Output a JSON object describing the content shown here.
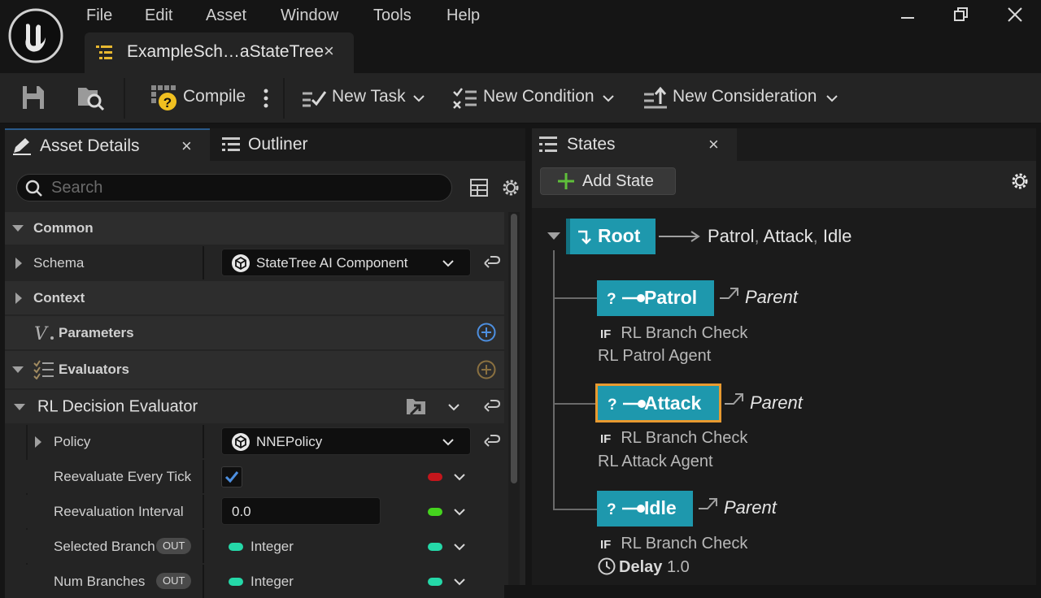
{
  "menu": [
    "File",
    "Edit",
    "Asset",
    "Window",
    "Tools",
    "Help"
  ],
  "document_tab": {
    "title": "ExampleSch…aStateTree",
    "close": "×"
  },
  "toolbar": {
    "compile": "Compile",
    "new_task": "New Task",
    "new_condition": "New Condition",
    "new_consideration": "New Consideration"
  },
  "left_tabs": {
    "asset_details": "Asset Details",
    "outliner": "Outliner",
    "close": "×"
  },
  "search": {
    "placeholder": "Search"
  },
  "details": {
    "common": "Common",
    "schema": {
      "label": "Schema",
      "value": "StateTree AI Component"
    },
    "context": "Context",
    "parameters": "Parameters",
    "evaluators": "Evaluators",
    "evaluator": "RL Decision Evaluator",
    "policy": {
      "label": "Policy",
      "value": "NNEPolicy"
    },
    "reevaluate": {
      "label": "Reevaluate Every Tick",
      "checked": true
    },
    "interval": {
      "label": "Reevaluation Interval",
      "value": "0.0"
    },
    "selected_branch": {
      "label": "Selected Branch",
      "badge": "OUT",
      "type": "Integer"
    },
    "num_branches": {
      "label": "Num Branches",
      "badge": "OUT",
      "type": "Integer"
    }
  },
  "states_panel": {
    "tab": "States",
    "close": "×",
    "add_state": "Add State"
  },
  "tree": {
    "root": {
      "label": "Root",
      "children": [
        "Patrol",
        "Attack",
        "Idle"
      ],
      "sep": ","
    },
    "states": [
      {
        "label": "Patrol",
        "transition": "Parent",
        "if": "IF",
        "condition": "RL Branch Check",
        "task": "RL Patrol Agent"
      },
      {
        "label": "Attack",
        "transition": "Parent",
        "if": "IF",
        "condition": "RL Branch Check",
        "task": "RL Attack Agent"
      },
      {
        "label": "Idle",
        "transition": "Parent",
        "if": "IF",
        "condition": "RL Branch Check",
        "delay_label": "Delay",
        "delay_value": "1.0"
      }
    ]
  },
  "colors": {
    "state": "#1e98ad",
    "selected": "#e89a30",
    "pin_red": "#c4161c",
    "pin_green": "#45d41e",
    "pin_teal": "#25d8a8",
    "accent_blue": "#4d8fe0"
  }
}
